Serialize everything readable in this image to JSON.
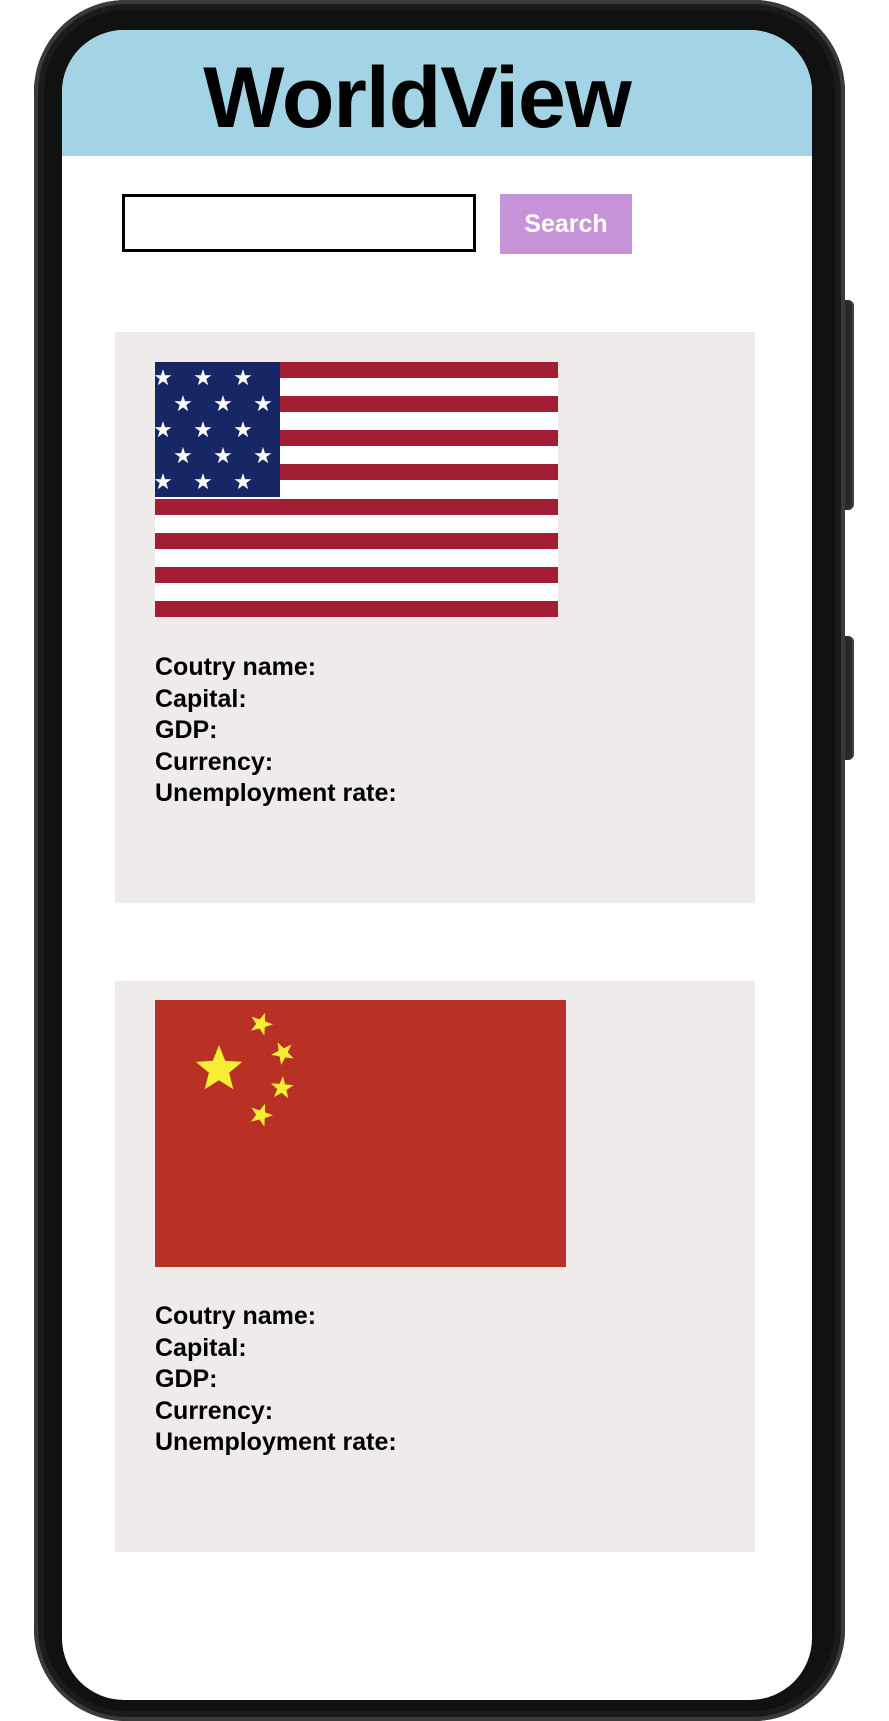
{
  "app": {
    "title": "WorldView"
  },
  "search": {
    "value": "",
    "placeholder": "",
    "button_label": "Search"
  },
  "countries": [
    {
      "flag": "usa-flag",
      "fields": {
        "name_label": "Coutry name:",
        "capital_label": "Capital:",
        "gdp_label": "GDP:",
        "currency_label": "Currency:",
        "unemployment_label": "Unemployment rate:"
      }
    },
    {
      "flag": "china-flag",
      "fields": {
        "name_label": "Coutry name:",
        "capital_label": "Capital:",
        "gdp_label": "GDP:",
        "currency_label": "Currency:",
        "unemployment_label": "Unemployment rate:"
      }
    }
  ],
  "colors": {
    "header_bg": "#a3d4e5",
    "search_button_bg": "#c794d9",
    "card_bg": "#f0ebeb",
    "usa_red": "#a31d34",
    "usa_blue": "#172766",
    "china_red": "#b93124",
    "china_star": "#f6ee33"
  }
}
